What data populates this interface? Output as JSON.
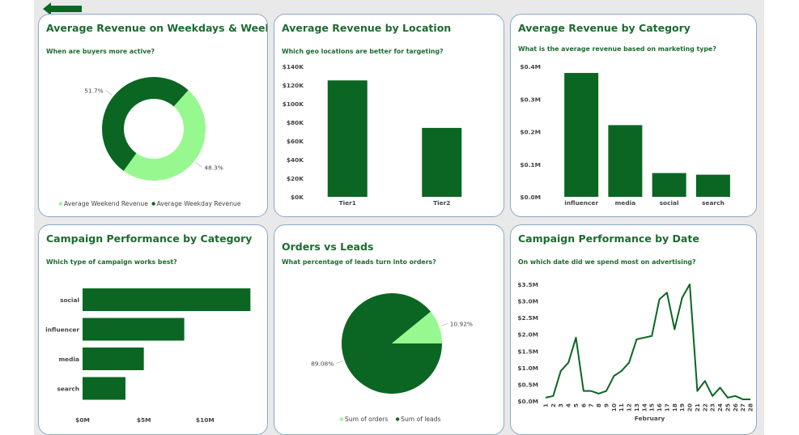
{
  "colors": {
    "dark_green": "#0b6623",
    "light_green": "#98f890",
    "title_green": "#1d6b30",
    "card_border": "#8aa9c9"
  },
  "nav": {
    "back_icon": "left-arrow-icon"
  },
  "cards": [
    {
      "title": "Average Revenue on Weekdays & Weekends",
      "subtitle": "When are buyers more active?"
    },
    {
      "title": "Average Revenue by Location",
      "subtitle": "Which geo locations are better for targeting?"
    },
    {
      "title": "Average Revenue by Category",
      "subtitle": "What is the average revenue based on marketing type?"
    },
    {
      "title": "Campaign Performance by Category",
      "subtitle": "Which type of campaign works best?"
    },
    {
      "title": "Orders vs Leads",
      "subtitle": "What percentage of leads turn into orders?"
    },
    {
      "title": "Campaign Performance by Date",
      "subtitle": "On which date did we spend most on advertising?"
    }
  ],
  "chart_data": [
    {
      "type": "pie",
      "donut": true,
      "title": "Average Revenue on Weekdays & Weekends",
      "slices": [
        {
          "name": "Average Weekend Revenue",
          "value": 48.3,
          "label": "48.3%",
          "color": "#98f890"
        },
        {
          "name": "Average Weekday Revenue",
          "value": 51.7,
          "label": "51.7%",
          "color": "#0b6623"
        }
      ],
      "legend": "bottom"
    },
    {
      "type": "bar",
      "title": "Average Revenue by Location",
      "categories": [
        "Tier1",
        "Tier2"
      ],
      "values": [
        125000,
        74000
      ],
      "ylim": [
        0,
        140000
      ],
      "yticks": [
        "$0K",
        "$20K",
        "$40K",
        "$60K",
        "$80K",
        "$100K",
        "$120K",
        "$140K"
      ],
      "grid": false
    },
    {
      "type": "bar",
      "title": "Average Revenue by Category",
      "categories": [
        "influencer",
        "media",
        "social",
        "search"
      ],
      "values": [
        0.38,
        0.22,
        0.073,
        0.068
      ],
      "ylim": [
        0,
        0.4
      ],
      "yticks": [
        "$0.0M",
        "$0.1M",
        "$0.2M",
        "$0.3M",
        "$0.4M"
      ],
      "grid": false
    },
    {
      "type": "bar",
      "orientation": "horizontal",
      "title": "Campaign Performance by Category",
      "categories": [
        "social",
        "influencer",
        "media",
        "search"
      ],
      "values": [
        13.7,
        8.3,
        5.0,
        3.5
      ],
      "xlim": [
        0,
        15
      ],
      "xticks": [
        "$0M",
        "$5M",
        "$10M"
      ],
      "grid": false
    },
    {
      "type": "pie",
      "title": "Orders vs Leads",
      "slices": [
        {
          "name": "Sum of orders",
          "value": 10.92,
          "label": "10.92%",
          "color": "#98f890"
        },
        {
          "name": "Sum of leads",
          "value": 89.08,
          "label": "89.08%",
          "color": "#0b6623"
        }
      ],
      "legend": "bottom"
    },
    {
      "type": "line",
      "title": "Campaign Performance by Date",
      "xlabel": "February",
      "x": [
        "1",
        "2",
        "3",
        "4",
        "5",
        "6",
        "7",
        "8",
        "9",
        "10",
        "11",
        "12",
        "13",
        "14",
        "15",
        "16",
        "17",
        "18",
        "19",
        "20",
        "21",
        "22",
        "23",
        "24",
        "25",
        "26",
        "27",
        "28"
      ],
      "series": [
        {
          "values": [
            0.1,
            0.15,
            0.9,
            1.15,
            1.9,
            0.3,
            0.3,
            0.22,
            0.3,
            0.75,
            0.9,
            1.15,
            1.85,
            1.9,
            1.95,
            3.05,
            3.25,
            2.15,
            3.1,
            3.5,
            0.3,
            0.6,
            0.15,
            0.4,
            0.1,
            0.15,
            0.05,
            0.05
          ]
        }
      ],
      "ylim": [
        0,
        3.5
      ],
      "yticks": [
        "$0.0M",
        "$0.5M",
        "$1.0M",
        "$1.5M",
        "$2.0M",
        "$2.5M",
        "$3.0M",
        "$3.5M"
      ],
      "grid": false
    }
  ]
}
